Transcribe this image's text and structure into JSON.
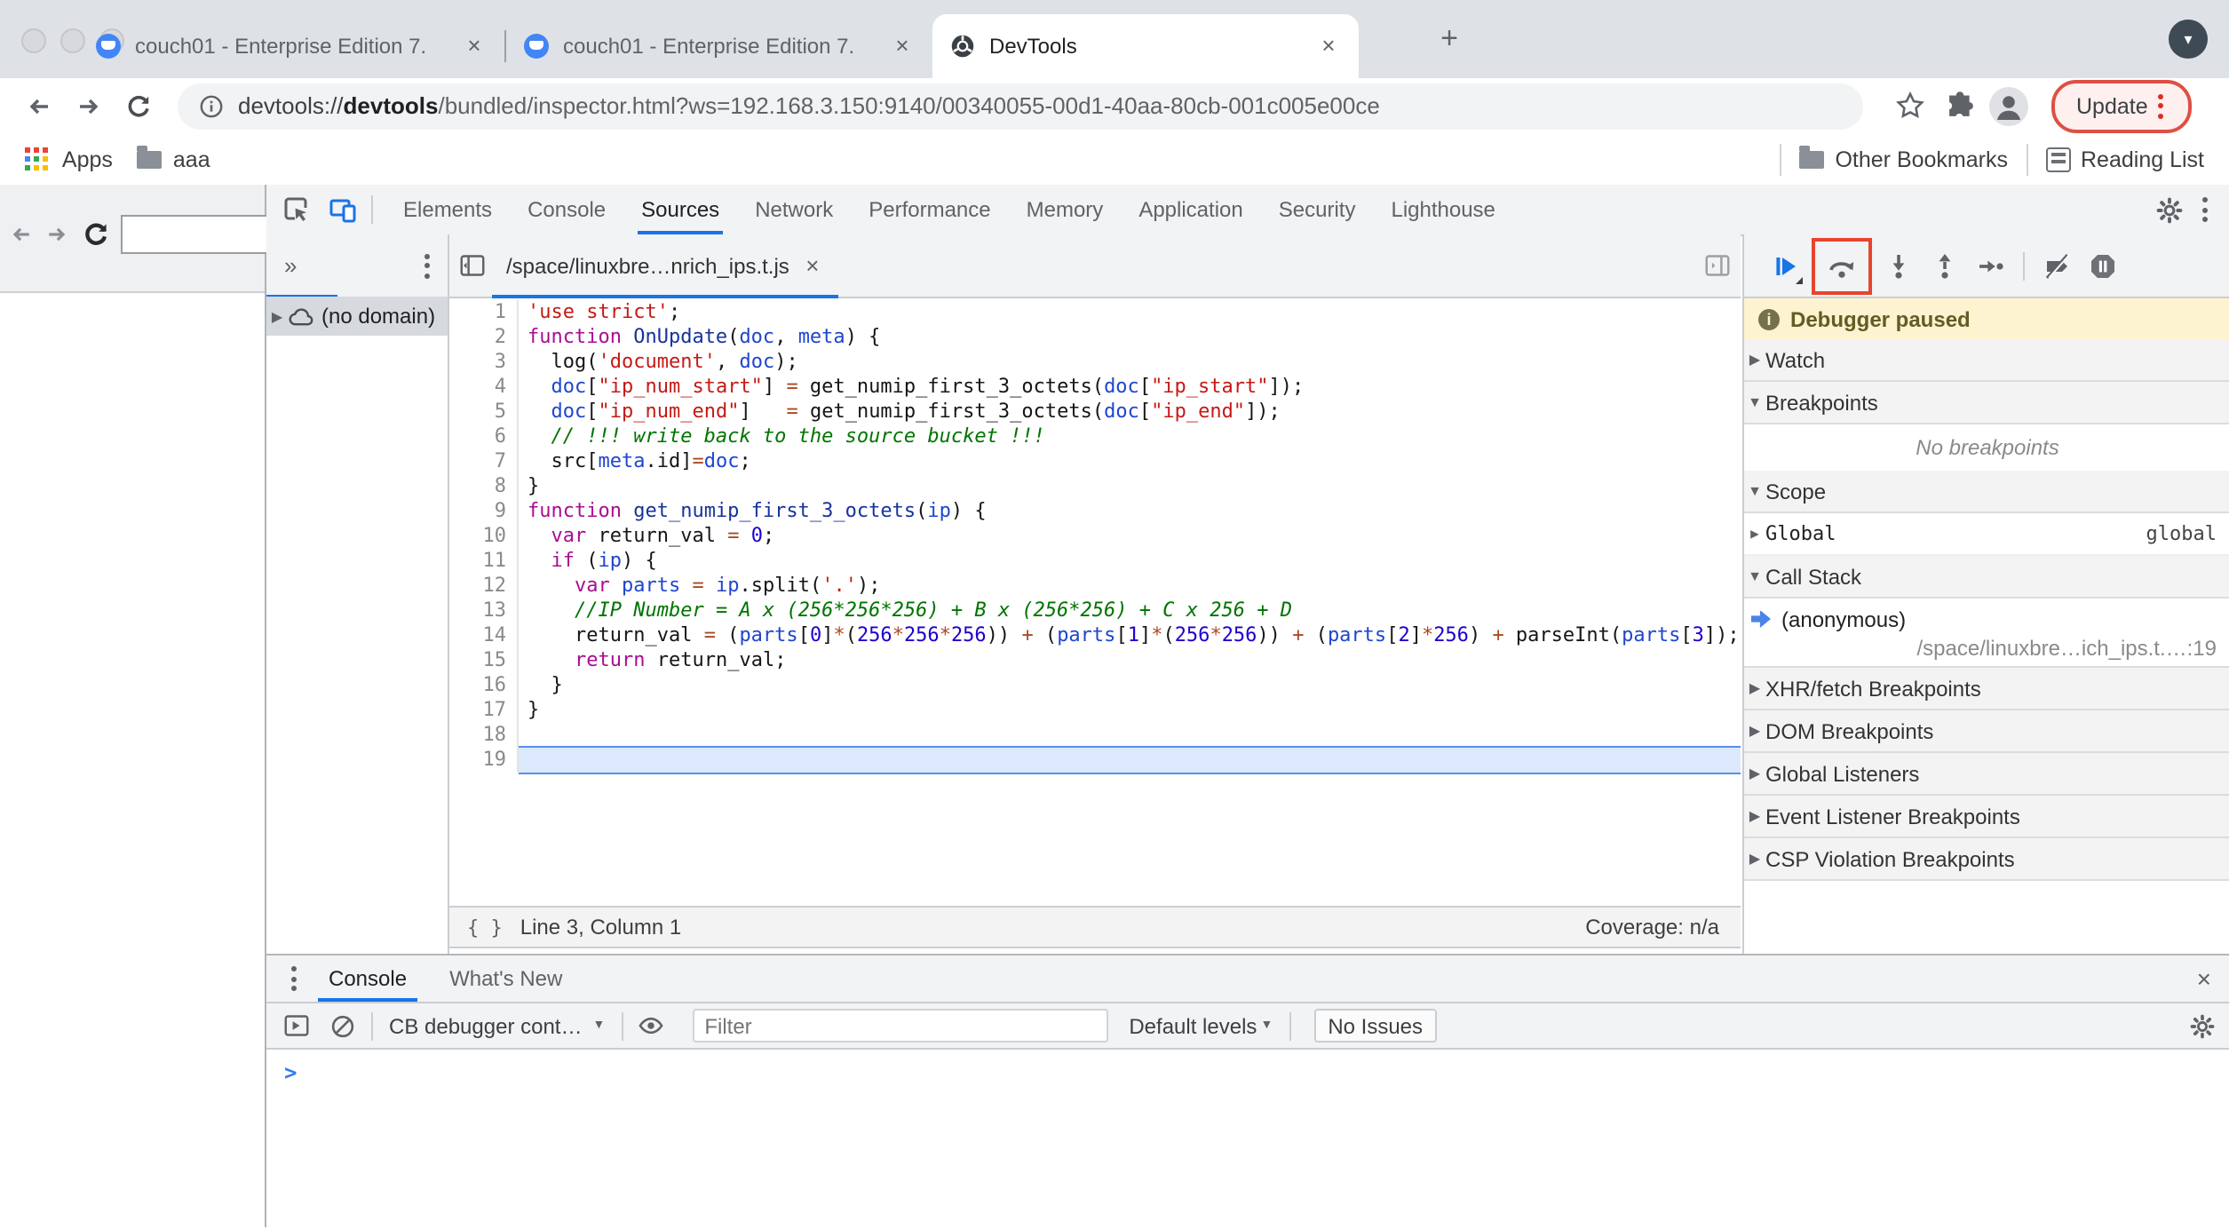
{
  "browser": {
    "tabs": [
      {
        "title": "couch01 - Enterprise Edition 7.",
        "favicon": "couchbase",
        "active": false
      },
      {
        "title": "couch01 - Enterprise Edition 7.",
        "favicon": "couchbase",
        "active": false
      },
      {
        "title": "DevTools",
        "favicon": "devtools",
        "active": true
      }
    ],
    "url": {
      "prefix": "devtools://",
      "host": "devtools",
      "rest": "/bundled/inspector.html?ws=192.168.3.150:9140/00340055-00d1-40aa-80cb-001c005e00ce"
    },
    "update_label": "Update",
    "bookmarks": {
      "apps": "Apps",
      "folder": "aaa",
      "other": "Other Bookmarks",
      "reading": "Reading List"
    }
  },
  "devtools": {
    "panel_tabs": [
      "Elements",
      "Console",
      "Sources",
      "Network",
      "Performance",
      "Memory",
      "Application",
      "Security",
      "Lighthouse"
    ],
    "active_panel": "Sources",
    "sources": {
      "navigator_more": "»",
      "navigator_item": "(no domain)",
      "file_tab": "/space/linuxbre…nrich_ips.t.js",
      "status_position": "Line 3, Column 1",
      "status_coverage": "Coverage: n/a",
      "highlighted_line": 19,
      "code_lines": [
        {
          "n": 1,
          "tokens": [
            [
              "'use strict'",
              "s"
            ],
            [
              ";",
              "p"
            ]
          ]
        },
        {
          "n": 2,
          "tokens": [
            [
              "function",
              "k"
            ],
            [
              " ",
              "p"
            ],
            [
              "OnUpdate",
              "d"
            ],
            [
              "(",
              "p"
            ],
            [
              "doc",
              "v"
            ],
            [
              ", ",
              "p"
            ],
            [
              "meta",
              "v"
            ],
            [
              ") {",
              "p"
            ]
          ]
        },
        {
          "n": 3,
          "tokens": [
            [
              "  log(",
              "p"
            ],
            [
              "'document'",
              "s"
            ],
            [
              ", ",
              "p"
            ],
            [
              "doc",
              "v"
            ],
            [
              ");",
              "p"
            ]
          ]
        },
        {
          "n": 4,
          "tokens": [
            [
              "  ",
              "p"
            ],
            [
              "doc",
              "v"
            ],
            [
              "[",
              "p"
            ],
            [
              "\"ip_num_start\"",
              "s"
            ],
            [
              "] ",
              "p"
            ],
            [
              "=",
              "o"
            ],
            [
              " get_numip_first_3_octets(",
              "p"
            ],
            [
              "doc",
              "v"
            ],
            [
              "[",
              "p"
            ],
            [
              "\"ip_start\"",
              "s"
            ],
            [
              "]);",
              "p"
            ]
          ]
        },
        {
          "n": 5,
          "tokens": [
            [
              "  ",
              "p"
            ],
            [
              "doc",
              "v"
            ],
            [
              "[",
              "p"
            ],
            [
              "\"ip_num_end\"",
              "s"
            ],
            [
              "]   ",
              "p"
            ],
            [
              "=",
              "o"
            ],
            [
              " get_numip_first_3_octets(",
              "p"
            ],
            [
              "doc",
              "v"
            ],
            [
              "[",
              "p"
            ],
            [
              "\"ip_end\"",
              "s"
            ],
            [
              "]);",
              "p"
            ]
          ]
        },
        {
          "n": 6,
          "tokens": [
            [
              "  ",
              "p"
            ],
            [
              "// !!! write back to the source bucket !!!",
              "c"
            ]
          ]
        },
        {
          "n": 7,
          "tokens": [
            [
              "  src[",
              "p"
            ],
            [
              "meta",
              "v"
            ],
            [
              ".id]",
              "p"
            ],
            [
              "=",
              "o"
            ],
            [
              "doc",
              "v"
            ],
            [
              ";",
              "p"
            ]
          ]
        },
        {
          "n": 8,
          "tokens": [
            [
              "}",
              "p"
            ]
          ]
        },
        {
          "n": 9,
          "tokens": [
            [
              "function",
              "k"
            ],
            [
              " ",
              "p"
            ],
            [
              "get_numip_first_3_octets",
              "d"
            ],
            [
              "(",
              "p"
            ],
            [
              "ip",
              "v"
            ],
            [
              ") {",
              "p"
            ]
          ]
        },
        {
          "n": 10,
          "tokens": [
            [
              "  ",
              "p"
            ],
            [
              "var",
              "k"
            ],
            [
              " return_val ",
              "p"
            ],
            [
              "=",
              "o"
            ],
            [
              " ",
              "p"
            ],
            [
              "0",
              "n"
            ],
            [
              ";",
              "p"
            ]
          ]
        },
        {
          "n": 11,
          "tokens": [
            [
              "  ",
              "p"
            ],
            [
              "if",
              "k"
            ],
            [
              " (",
              "p"
            ],
            [
              "ip",
              "v"
            ],
            [
              ") {",
              "p"
            ]
          ]
        },
        {
          "n": 12,
          "tokens": [
            [
              "    ",
              "p"
            ],
            [
              "var",
              "k"
            ],
            [
              " ",
              "p"
            ],
            [
              "parts",
              "v"
            ],
            [
              " ",
              "p"
            ],
            [
              "=",
              "o"
            ],
            [
              " ",
              "p"
            ],
            [
              "ip",
              "v"
            ],
            [
              ".split(",
              "p"
            ],
            [
              "'.'",
              "s"
            ],
            [
              ");",
              "p"
            ]
          ]
        },
        {
          "n": 13,
          "tokens": [
            [
              "    ",
              "p"
            ],
            [
              "//IP Number = A x (256*256*256) + B x (256*256) + C x 256 + D",
              "c"
            ]
          ]
        },
        {
          "n": 14,
          "tokens": [
            [
              "    return_val ",
              "p"
            ],
            [
              "=",
              "o"
            ],
            [
              " (",
              "p"
            ],
            [
              "parts",
              "v"
            ],
            [
              "[",
              "p"
            ],
            [
              "0",
              "n"
            ],
            [
              "]",
              "p"
            ],
            [
              "*",
              "o"
            ],
            [
              "(",
              "p"
            ],
            [
              "256",
              "n"
            ],
            [
              "*",
              "o"
            ],
            [
              "256",
              "n"
            ],
            [
              "*",
              "o"
            ],
            [
              "256",
              "n"
            ],
            [
              ")) ",
              "p"
            ],
            [
              "+",
              "o"
            ],
            [
              " (",
              "p"
            ],
            [
              "parts",
              "v"
            ],
            [
              "[",
              "p"
            ],
            [
              "1",
              "n"
            ],
            [
              "]",
              "p"
            ],
            [
              "*",
              "o"
            ],
            [
              "(",
              "p"
            ],
            [
              "256",
              "n"
            ],
            [
              "*",
              "o"
            ],
            [
              "256",
              "n"
            ],
            [
              ")) ",
              "p"
            ],
            [
              "+",
              "o"
            ],
            [
              " (",
              "p"
            ],
            [
              "parts",
              "v"
            ],
            [
              "[",
              "p"
            ],
            [
              "2",
              "n"
            ],
            [
              "]",
              "p"
            ],
            [
              "*",
              "o"
            ],
            [
              "256",
              "n"
            ],
            [
              ") ",
              "p"
            ],
            [
              "+",
              "o"
            ],
            [
              " parseInt(",
              "p"
            ],
            [
              "parts",
              "v"
            ],
            [
              "[",
              "p"
            ],
            [
              "3",
              "n"
            ],
            [
              "]);",
              "p"
            ]
          ]
        },
        {
          "n": 15,
          "tokens": [
            [
              "    ",
              "p"
            ],
            [
              "return",
              "k"
            ],
            [
              " return_val;",
              "p"
            ]
          ]
        },
        {
          "n": 16,
          "tokens": [
            [
              "  }",
              "p"
            ]
          ]
        },
        {
          "n": 17,
          "tokens": [
            [
              "}",
              "p"
            ]
          ]
        },
        {
          "n": 18,
          "tokens": []
        },
        {
          "n": 19,
          "tokens": []
        }
      ]
    },
    "debugger": {
      "banner": "Debugger paused",
      "rows": [
        {
          "kind": "header",
          "expanded": false,
          "label": "Watch"
        },
        {
          "kind": "header",
          "expanded": true,
          "label": "Breakpoints"
        },
        {
          "kind": "empty",
          "label": "No breakpoints"
        },
        {
          "kind": "header",
          "expanded": true,
          "label": "Scope"
        },
        {
          "kind": "kv",
          "name": "Global",
          "value": "global"
        },
        {
          "kind": "header",
          "expanded": true,
          "label": "Call Stack"
        },
        {
          "kind": "frame",
          "name": "(anonymous)",
          "location": "/space/linuxbre…ich_ips.t.…:19"
        },
        {
          "kind": "header",
          "expanded": false,
          "label": "XHR/fetch Breakpoints"
        },
        {
          "kind": "header",
          "expanded": false,
          "label": "DOM Breakpoints"
        },
        {
          "kind": "header",
          "expanded": false,
          "label": "Global Listeners"
        },
        {
          "kind": "header",
          "expanded": false,
          "label": "Event Listener Breakpoints"
        },
        {
          "kind": "header",
          "expanded": false,
          "label": "CSP Violation Breakpoints"
        }
      ]
    },
    "console": {
      "tabs": [
        "Console",
        "What's New"
      ],
      "active_tab": "Console",
      "context_selector": "CB debugger cont…",
      "filter_placeholder": "Filter",
      "levels_label": "Default levels",
      "issues_label": "No Issues",
      "prompt": ">"
    }
  }
}
